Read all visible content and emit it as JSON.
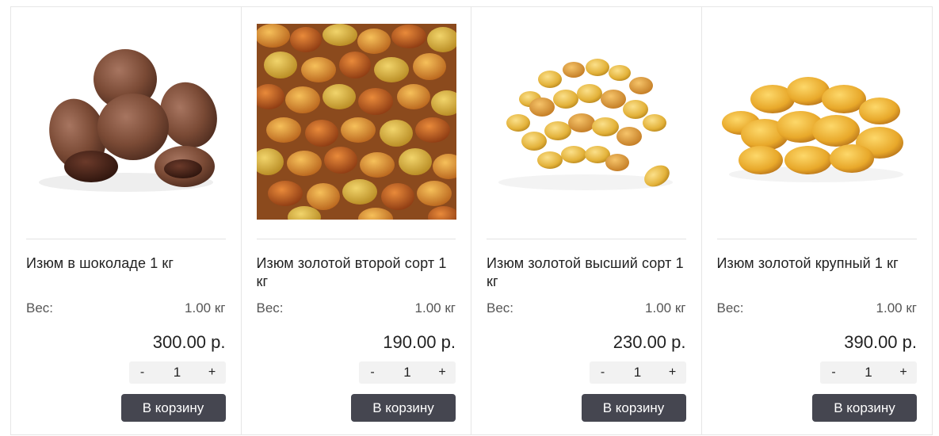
{
  "products": [
    {
      "name": "Изюм в шоколаде 1 кг",
      "weight_label": "Вес:",
      "weight_value": "1.00 кг",
      "price": "300.00 р.",
      "quantity": "1",
      "minus": "-",
      "plus": "+",
      "button": "В корзину",
      "image": "chocolate-raisins"
    },
    {
      "name": "Изюм золотой второй сорт 1 кг",
      "weight_label": "Вес:",
      "weight_value": "1.00 кг",
      "price": "190.00 р.",
      "quantity": "1",
      "minus": "-",
      "plus": "+",
      "button": "В корзину",
      "image": "golden-raisins-closeup"
    },
    {
      "name": "Изюм золотой высший сорт 1 кг",
      "weight_label": "Вес:",
      "weight_value": "1.00 кг",
      "price": "230.00 р.",
      "quantity": "1",
      "minus": "-",
      "plus": "+",
      "button": "В корзину",
      "image": "golden-raisins-pile"
    },
    {
      "name": "Изюм золотой крупный 1 кг",
      "weight_label": "Вес:",
      "weight_value": "1.00 кг",
      "price": "390.00 р.",
      "quantity": "1",
      "minus": "-",
      "plus": "+",
      "button": "В корзину",
      "image": "large-golden-raisins"
    }
  ],
  "colors": {
    "button_bg": "#454650",
    "qty_bg": "#f2f2f2",
    "border": "#e6e6e6"
  }
}
